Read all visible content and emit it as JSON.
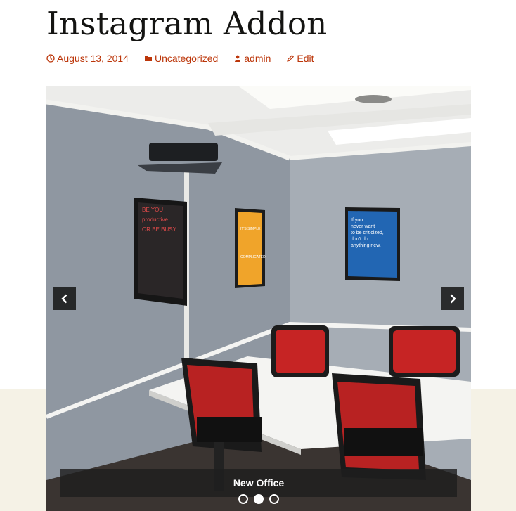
{
  "post": {
    "title": "Instagram Addon",
    "meta": {
      "date": "August 13, 2014",
      "category": "Uncategorized",
      "author": "admin",
      "edit": "Edit"
    }
  },
  "slider": {
    "caption": "New Office",
    "slide_count": 3,
    "active_slide": 2,
    "posters": [
      {
        "lines": [
          "BE YOU",
          "productive",
          "OR BE BUSY"
        ]
      },
      {
        "lines": [
          "IT'S SIMPLE",
          "COMPLICATED"
        ]
      },
      {
        "lines": [
          "If you",
          "never want",
          "to be criticized,",
          "don't do",
          "anything new."
        ]
      }
    ]
  },
  "colors": {
    "accent": "#bc360a",
    "title": "#141412",
    "band": "#f5f2e6"
  }
}
